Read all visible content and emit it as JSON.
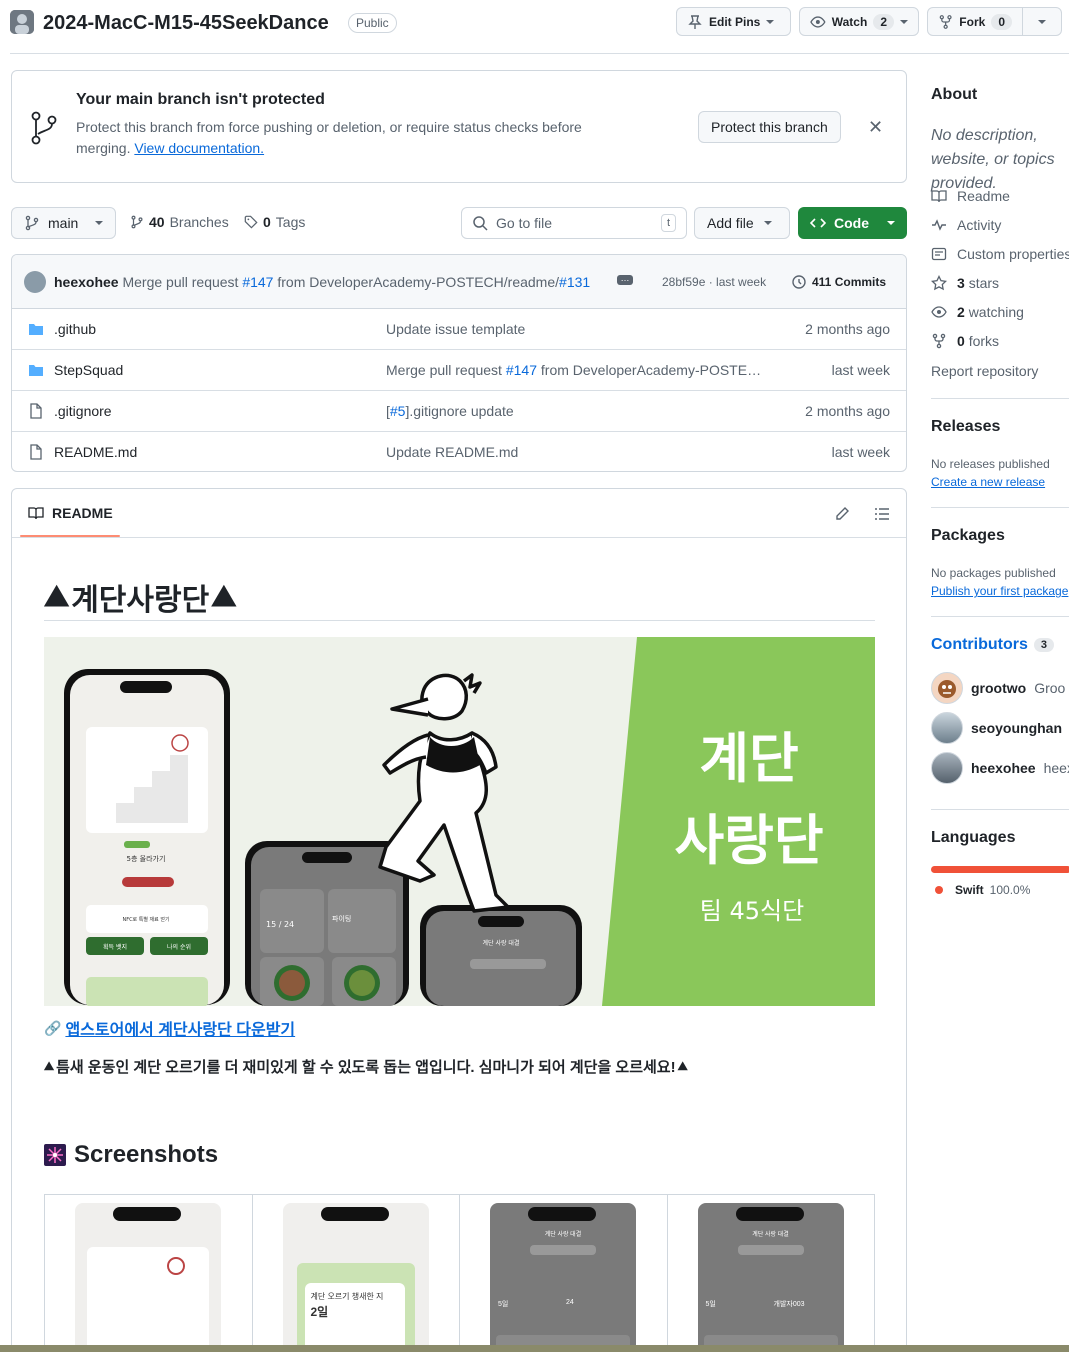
{
  "repo": {
    "name": "2024-MacC-M15-45SeekDance",
    "visibility": "Public",
    "actions": {
      "edit_pins": "Edit Pins",
      "watch": "Watch",
      "watch_count": "2",
      "fork": "Fork",
      "fork_count": "0"
    }
  },
  "banner": {
    "title": "Your main branch isn't protected",
    "text": "Protect this branch from force pushing or deletion, or require status checks before merging.",
    "link": "View documentation.",
    "button": "Protect this branch"
  },
  "toolbar": {
    "branch": "main",
    "branches_count": "40",
    "branches_label": "Branches",
    "tags_count": "0",
    "tags_label": "Tags",
    "goto_placeholder": "Go to file",
    "goto_key": "t",
    "add_file": "Add file",
    "code": "Code"
  },
  "commit": {
    "author": "heexohee",
    "msg_prefix": "Merge pull request",
    "pr": "#147",
    "msg_mid": "from DeveloperAcademy-POSTECH/readme/",
    "issue": "#131",
    "hash": "28bf59e · last week",
    "commits": "411 Commits"
  },
  "files": [
    {
      "name": ".github",
      "type": "folder",
      "message": "Update issue template",
      "date": "2 months ago"
    },
    {
      "name": "StepSquad",
      "type": "folder",
      "message_prefix": "Merge pull request",
      "message_link": "#147",
      "message": "from DeveloperAcademy-POSTE…",
      "date": "last week"
    },
    {
      "name": ".gitignore",
      "type": "file",
      "message_prefix": "[",
      "message_link": "#5",
      "message": "].gitignore update",
      "date": "2 months ago"
    },
    {
      "name": "README.md",
      "type": "file",
      "message": "Update README.md",
      "date": "last week"
    }
  ],
  "readme": {
    "tab": "README",
    "title": "계단사랑단",
    "banner_text1": "계단",
    "banner_text2": "사랑단",
    "banner_text3": "팀 45식단",
    "phone_texts": {
      "a1": "5층 올라가기",
      "a2": "NFC로 특별 재료 얻기",
      "a3": "획득 뱃지",
      "a4": "나의 순위",
      "b1": "15 / 24",
      "b2": "파이팅",
      "c1": "계단 사랑 대결"
    },
    "store_link": "앱스토어에서 계단사랑단 다운받기",
    "description": "틈새 운동인 계단 오르기를 더 재미있게 할 수 있도록 돕는 앱입니다. 심마니가 되어 계단을 오르세요!",
    "screenshots_title": "Screenshots",
    "shot_texts": {
      "s2a": "계단 오르기 챙새한 지",
      "s2b": "2일",
      "s3a": "계단 사랑 대결",
      "s4a": "계단 사랑 대결",
      "s3b": "5일",
      "s3c": "24",
      "s4b": "5일",
      "s4c": "개발자003"
    }
  },
  "about": {
    "title": "About",
    "description": "No description, website, or topics provided.",
    "items": [
      {
        "icon": "book-icon",
        "label": "Readme"
      },
      {
        "icon": "pulse-icon",
        "label": "Activity"
      },
      {
        "icon": "note-icon",
        "label": "Custom properties"
      },
      {
        "icon": "star-icon",
        "count": "3",
        "label": "stars"
      },
      {
        "icon": "eye-icon",
        "count": "2",
        "label": "watching"
      },
      {
        "icon": "fork-icon",
        "count": "0",
        "label": "forks"
      }
    ],
    "report": "Report repository"
  },
  "releases": {
    "title": "Releases",
    "text": "No releases published",
    "link": "Create a new release"
  },
  "packages": {
    "title": "Packages",
    "text": "No packages published",
    "link": "Publish your first package"
  },
  "contributors": {
    "title": "Contributors",
    "count": "3",
    "people": [
      {
        "login": "grootwo",
        "name": "Groo"
      },
      {
        "login": "seoyounghan",
        "name": "s"
      },
      {
        "login": "heexohee",
        "name": "heex"
      }
    ]
  },
  "languages": {
    "title": "Languages",
    "items": [
      {
        "name": "Swift",
        "percent": "100.0%",
        "color": "#F05138",
        "share": 100
      }
    ]
  },
  "colors": {
    "accent": "#0969da",
    "primary_button": "#1f883d",
    "swift": "#F05138",
    "banner_green": "#8ac75a"
  }
}
